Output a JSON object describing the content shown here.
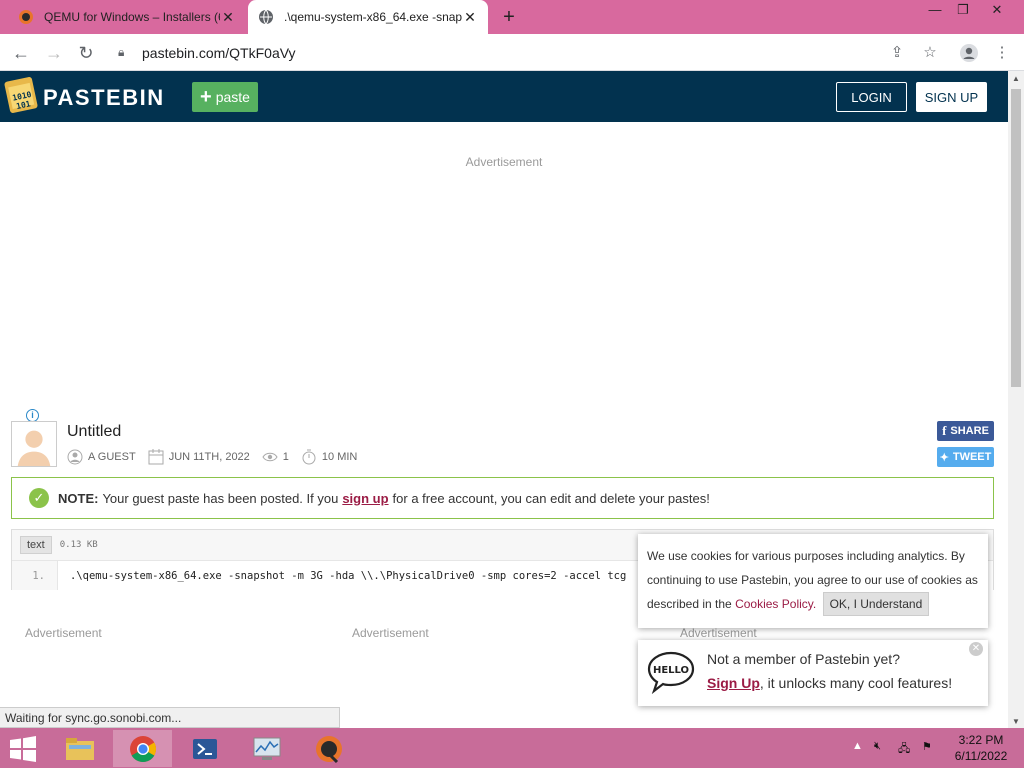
{
  "browser": {
    "tabs": [
      {
        "title": "QEMU for Windows – Installers (6",
        "state": "inactive"
      },
      {
        "title": ".\\qemu-system-x86_64.exe -snap",
        "state": "active"
      }
    ],
    "new_tab_label": "+",
    "url": "pastebin.com/QTkF0aVy"
  },
  "header": {
    "brand": "PASTEBIN",
    "paste_label": "paste",
    "login_label": "LOGIN",
    "signup_label": "SIGN UP",
    "bg_color": "#02324f"
  },
  "ads": {
    "top_label": "Advertisement",
    "bottom_labels": [
      "Advertisement",
      "Advertisement",
      "Advertisement"
    ]
  },
  "paste": {
    "title": "Untitled",
    "author": "A GUEST",
    "date": "JUN 11TH, 2022",
    "views": "1",
    "expires": "10 MIN",
    "share_label": "SHARE",
    "tweet_label": "TWEET"
  },
  "notice": {
    "bold": "NOTE:",
    "text_before": "Your guest paste has been posted. If you",
    "link": "sign up",
    "text_after": "for a free account, you can edit and delete your pastes!"
  },
  "code": {
    "syntax": "text",
    "size": "0.13 KB",
    "line_number": "1.",
    "line_text": ".\\qemu-system-x86_64.exe -snapshot -m 3G -hda \\\\.\\PhysicalDrive0 -smp cores=2 -accel tcg"
  },
  "cookie": {
    "text": "We use cookies for various purposes including analytics. By continuing to use Pastebin, you agree to our use of cookies as described in the",
    "link": "Cookies Policy.",
    "button": "OK, I Understand"
  },
  "hello_popup": {
    "bubble_text": "HELLO",
    "line1": "Not a member of Pastebin yet?",
    "signup": "Sign Up",
    "line2_rest": ", it unlocks many cool features!"
  },
  "status_text": "Waiting for sync.go.sonobi.com...",
  "taskbar": {
    "time": "3:22 PM",
    "date": "6/11/2022"
  },
  "colors": {
    "tabbar": "#d8699e",
    "taskbar": "#c86c99",
    "green": "#57b160",
    "link": "#9b1c45"
  }
}
